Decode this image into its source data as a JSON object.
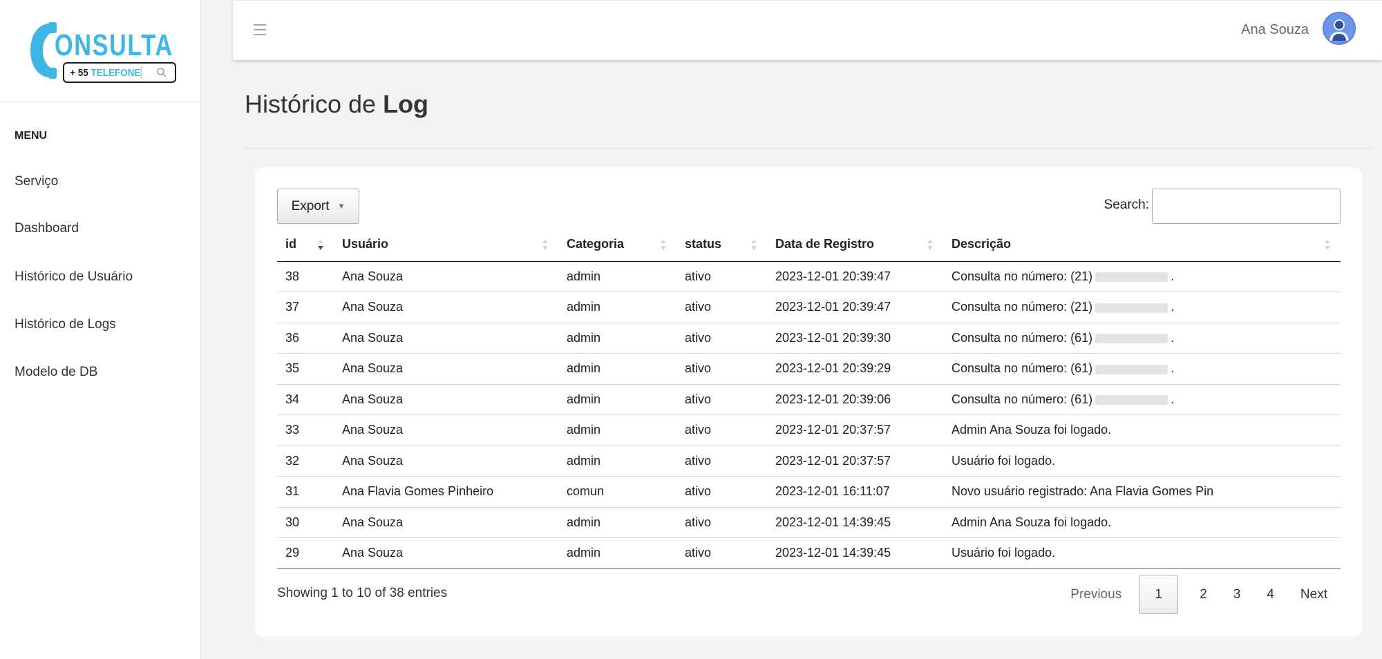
{
  "logo": {
    "word": "ONSULTA",
    "prefix": "+ 55",
    "tel": "TELEFONE"
  },
  "sidebar": {
    "menu_title": "MENU",
    "items": [
      {
        "label": "Serviço"
      },
      {
        "label": "Dashboard"
      },
      {
        "label": "Histórico de Usuário"
      },
      {
        "label": "Histórico de Logs"
      },
      {
        "label": "Modelo de DB"
      }
    ]
  },
  "topbar": {
    "user_name": "Ana Souza"
  },
  "page": {
    "title_pre": "Histórico de ",
    "title_bold": "Log"
  },
  "toolbar": {
    "export_label": "Export",
    "search_label": "Search:",
    "search_value": ""
  },
  "table": {
    "headers": [
      "id",
      "Usuário",
      "Categoria",
      "status",
      "Data de Registro",
      "Descrição"
    ],
    "rows": [
      {
        "id": "38",
        "usuario": "Ana Souza",
        "categoria": "admin",
        "status": "ativo",
        "data": "2023-12-01 20:39:47",
        "desc": "Consulta no número: (21)",
        "redacted": true,
        "suffix": "."
      },
      {
        "id": "37",
        "usuario": "Ana Souza",
        "categoria": "admin",
        "status": "ativo",
        "data": "2023-12-01 20:39:47",
        "desc": "Consulta no número: (21)",
        "redacted": true,
        "suffix": "."
      },
      {
        "id": "36",
        "usuario": "Ana Souza",
        "categoria": "admin",
        "status": "ativo",
        "data": "2023-12-01 20:39:30",
        "desc": "Consulta no número: (61)",
        "redacted": true,
        "suffix": "."
      },
      {
        "id": "35",
        "usuario": "Ana Souza",
        "categoria": "admin",
        "status": "ativo",
        "data": "2023-12-01 20:39:29",
        "desc": "Consulta no número: (61)",
        "redacted": true,
        "suffix": "."
      },
      {
        "id": "34",
        "usuario": "Ana Souza",
        "categoria": "admin",
        "status": "ativo",
        "data": "2023-12-01 20:39:06",
        "desc": "Consulta no número: (61)",
        "redacted": true,
        "suffix": "."
      },
      {
        "id": "33",
        "usuario": "Ana Souza",
        "categoria": "admin",
        "status": "ativo",
        "data": "2023-12-01 20:37:57",
        "desc": "Admin Ana Souza foi logado.",
        "redacted": false,
        "suffix": ""
      },
      {
        "id": "32",
        "usuario": "Ana Souza",
        "categoria": "admin",
        "status": "ativo",
        "data": "2023-12-01 20:37:57",
        "desc": "Usuário foi logado.",
        "redacted": false,
        "suffix": ""
      },
      {
        "id": "31",
        "usuario": "Ana Flavia Gomes Pinheiro",
        "categoria": "comun",
        "status": "ativo",
        "data": "2023-12-01 16:11:07",
        "desc": "Novo usuário registrado: Ana Flavia Gomes Pin",
        "redacted": false,
        "suffix": ""
      },
      {
        "id": "30",
        "usuario": "Ana Souza",
        "categoria": "admin",
        "status": "ativo",
        "data": "2023-12-01 14:39:45",
        "desc": "Admin Ana Souza foi logado.",
        "redacted": false,
        "suffix": ""
      },
      {
        "id": "29",
        "usuario": "Ana Souza",
        "categoria": "admin",
        "status": "ativo",
        "data": "2023-12-01 14:39:45",
        "desc": "Usuário foi logado.",
        "redacted": false,
        "suffix": ""
      }
    ]
  },
  "footer": {
    "info": "Showing 1 to 10 of 38 entries",
    "previous": "Previous",
    "pages": [
      "1",
      "2",
      "3",
      "4"
    ],
    "current_page": "1",
    "next": "Next"
  },
  "colors": {
    "brand_blue": "#3fb7e6",
    "avatar_blue": "#6f95e8"
  },
  "icons": {
    "menu": "hamburger-icon",
    "avatar": "user-avatar-icon",
    "sort": "sort-arrows-icon",
    "phone": "phone-icon",
    "search": "search-icon"
  }
}
